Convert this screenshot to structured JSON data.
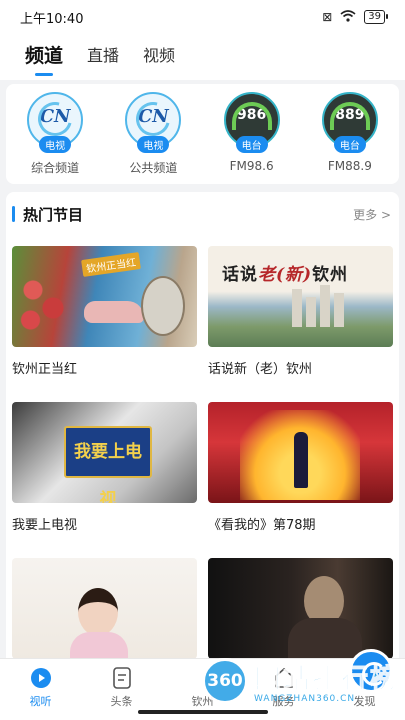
{
  "status_bar": {
    "time": "上午10:40",
    "battery": "39"
  },
  "top_tabs": [
    {
      "label": "频道",
      "active": true
    },
    {
      "label": "直播",
      "active": false
    },
    {
      "label": "视频",
      "active": false
    }
  ],
  "channels": [
    {
      "logo": "CN",
      "badge": "电视",
      "label": "综合频道"
    },
    {
      "logo": "CN",
      "badge": "电视",
      "label": "公共频道"
    },
    {
      "logo": "986",
      "badge": "电台",
      "label": "FM98.6"
    },
    {
      "logo": "889",
      "badge": "电台",
      "label": "FM88.9"
    }
  ],
  "hot": {
    "title": "热门节目",
    "more": "更多 >",
    "items": [
      {
        "title": "钦州正当红",
        "tag": "钦州正当红"
      },
      {
        "title": "话说新（老）钦州",
        "caption_pre": "话说",
        "caption_mid": "老(新)",
        "caption_post": "钦州"
      },
      {
        "title": "我要上电视",
        "logo": "我要上电视"
      },
      {
        "title": "《看我的》第78期"
      },
      {
        "title": ""
      },
      {
        "title": ""
      }
    ]
  },
  "bottom_nav": [
    {
      "label": "视听",
      "icon": "play-icon",
      "active": true
    },
    {
      "label": "头条",
      "icon": "news-icon",
      "active": false
    },
    {
      "label": "钦州",
      "icon": "city-icon",
      "active": false
    },
    {
      "label": "服务",
      "icon": "service-icon",
      "active": false
    },
    {
      "label": "发现",
      "icon": "discover-icon",
      "active": false
    }
  ],
  "watermark": {
    "badge": "360",
    "cn": "网站排行榜",
    "en": "WANGZHAN360.CN"
  },
  "colors": {
    "accent": "#1b8cf0",
    "background": "#f2f3f5"
  }
}
